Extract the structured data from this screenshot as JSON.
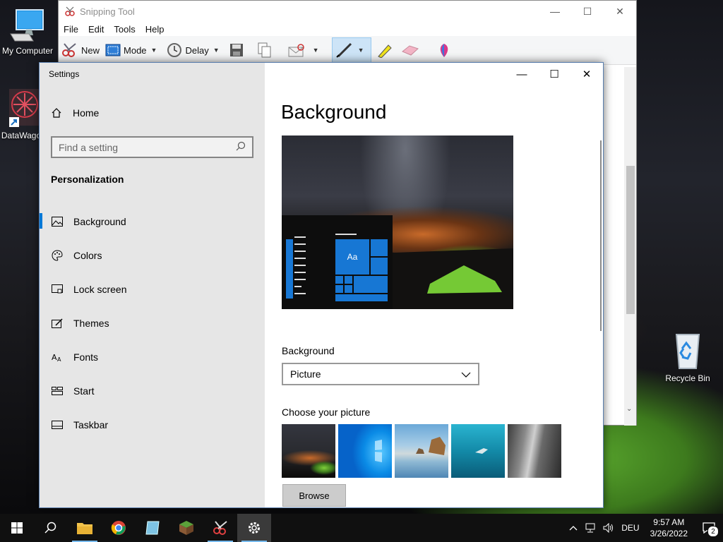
{
  "desktop": {
    "icons": [
      {
        "label": "My Computer"
      },
      {
        "label": "DataWago"
      },
      {
        "label": "Recycle Bin"
      }
    ]
  },
  "snipping_tool": {
    "title": "Snipping Tool",
    "menu": [
      "File",
      "Edit",
      "Tools",
      "Help"
    ],
    "toolbar": {
      "new": "New",
      "mode": "Mode",
      "delay": "Delay"
    }
  },
  "settings": {
    "window_title": "Settings",
    "home": "Home",
    "search_placeholder": "Find a setting",
    "section": "Personalization",
    "nav": [
      {
        "label": "Background",
        "icon": "picture-icon",
        "active": true
      },
      {
        "label": "Colors",
        "icon": "palette-icon"
      },
      {
        "label": "Lock screen",
        "icon": "lock-screen-icon"
      },
      {
        "label": "Themes",
        "icon": "themes-icon"
      },
      {
        "label": "Fonts",
        "icon": "fonts-icon"
      },
      {
        "label": "Start",
        "icon": "start-icon"
      },
      {
        "label": "Taskbar",
        "icon": "taskbar-icon"
      }
    ],
    "page_title": "Background",
    "preview_tile_text": "Aa",
    "background_label": "Background",
    "background_value": "Picture",
    "choose_label": "Choose your picture",
    "browse_label": "Browse",
    "accent_color": "#0078d7"
  },
  "taskbar": {
    "language": "DEU",
    "time": "9:57 AM",
    "date": "3/26/2022",
    "notification_count": "2"
  }
}
